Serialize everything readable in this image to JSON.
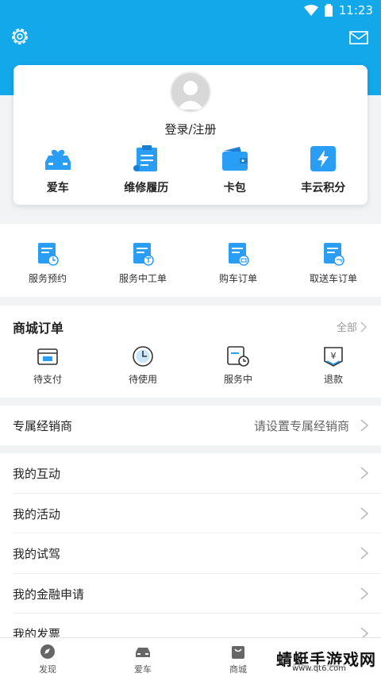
{
  "status_bar": {
    "time": "11:23"
  },
  "profile": {
    "login_text": "登录/注册"
  },
  "quick_actions": [
    {
      "label": "爱车",
      "icon": "car-icon"
    },
    {
      "label": "维修履历",
      "icon": "maintenance-history-icon"
    },
    {
      "label": "卡包",
      "icon": "wallet-icon"
    },
    {
      "label": "丰云积分",
      "icon": "points-icon"
    }
  ],
  "services": [
    {
      "label": "服务预约",
      "icon": "appointment-doc-icon"
    },
    {
      "label": "服务中工单",
      "icon": "work-order-icon"
    },
    {
      "label": "购车订单",
      "icon": "purchase-order-icon"
    },
    {
      "label": "取送车订单",
      "icon": "pickup-order-icon"
    }
  ],
  "mall_orders": {
    "title": "商城订单",
    "all_label": "全部",
    "items": [
      {
        "label": "待支付",
        "icon": "wallet-outline-icon"
      },
      {
        "label": "待使用",
        "icon": "clock-icon"
      },
      {
        "label": "服务中",
        "icon": "doc-clock-icon"
      },
      {
        "label": "退款",
        "icon": "refund-icon"
      }
    ]
  },
  "dealer": {
    "label": "专属经销商",
    "value": "请设置专属经销商"
  },
  "menu_items": [
    "我的互动",
    "我的活动",
    "我的试驾",
    "我的金融申请",
    "我的发票"
  ],
  "tabs": [
    {
      "label": "发现",
      "icon": "compass-icon"
    },
    {
      "label": "爱车",
      "icon": "car-icon"
    },
    {
      "label": "商城",
      "icon": "shopping-bag-icon"
    }
  ],
  "watermark": {
    "title": "蜻蜓手游戏网",
    "url": "www.qt6.com"
  },
  "colors": {
    "brand_blue": "#13a8ea",
    "icon_blue": "#2a9df4"
  }
}
